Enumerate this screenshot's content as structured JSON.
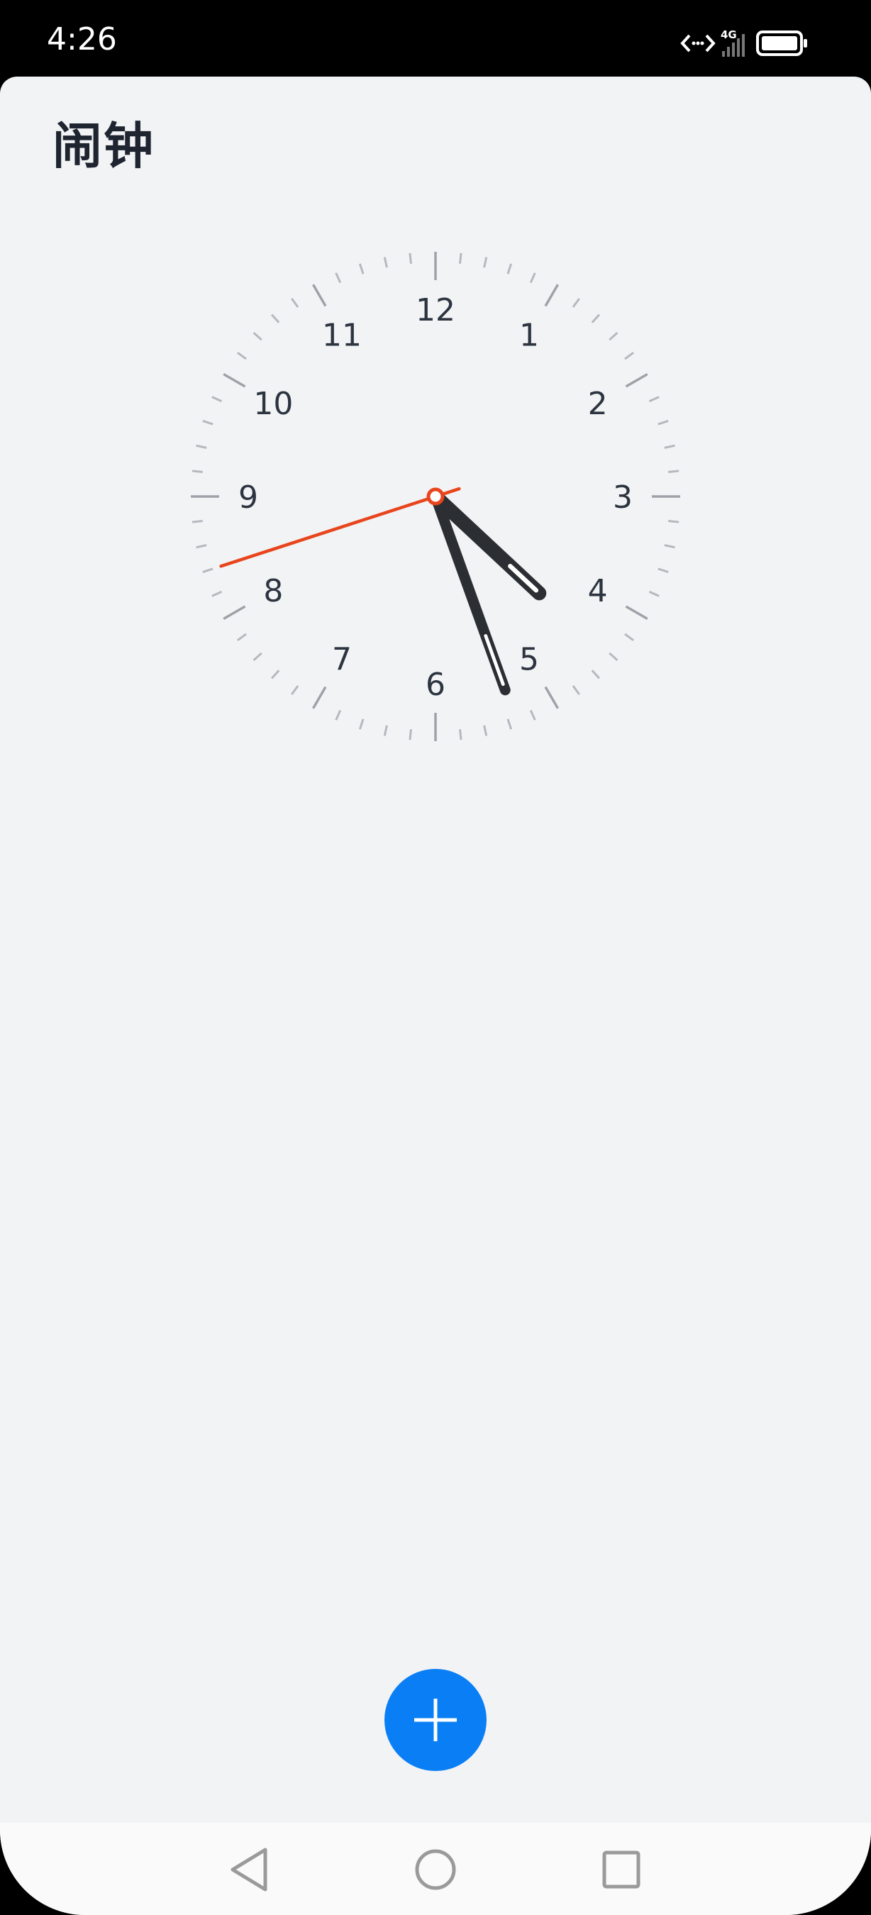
{
  "status_bar": {
    "time": "4:26",
    "network": "4G",
    "icons": [
      "data-transfer-icon",
      "signal-icon",
      "battery-icon"
    ]
  },
  "header": {
    "title": "闹钟"
  },
  "clock": {
    "numerals": [
      "12",
      "1",
      "2",
      "3",
      "4",
      "5",
      "6",
      "7",
      "8",
      "9",
      "10",
      "11"
    ],
    "time_shown": {
      "hour": 4,
      "minute": 26,
      "second": 42
    },
    "colors": {
      "hands": "#2b2e33",
      "second_hand": "#e8451c",
      "ticks": "#b5b8bd",
      "numerals": "#2c3440"
    }
  },
  "fab": {
    "icon": "plus-icon",
    "color": "#0a7ff5"
  },
  "nav_bar": {
    "icons": [
      "back-icon",
      "home-icon",
      "recents-icon"
    ]
  }
}
